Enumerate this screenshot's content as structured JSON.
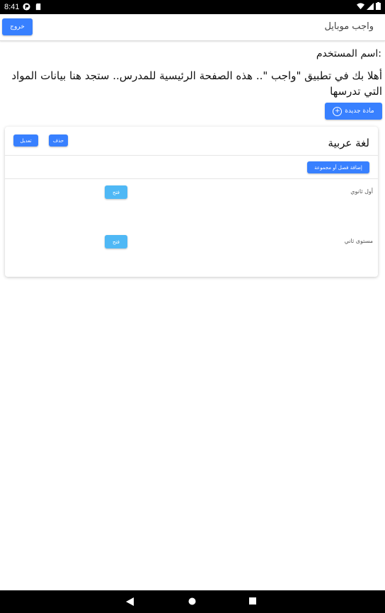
{
  "status": {
    "time": "8:41"
  },
  "appbar": {
    "title": "واجب موبايل",
    "logout_label": "خروج"
  },
  "main": {
    "username_label": "اسم المستخدم:",
    "welcome": "أهلا بك في تطبيق \"واجب \".. هذه الصفحة الرئيسية للمدرس.. ستجد هنا بيانات المواد التي تدرسها",
    "new_subject_label": "مادة جديدة"
  },
  "subject_card": {
    "title": "لغة عربية",
    "edit_label": "تعديل",
    "delete_label": "حذف",
    "add_class_label": "إضافة فصل أو مجموعة",
    "groups": [
      {
        "name": "أول ثانوي",
        "open_label": "فتح"
      },
      {
        "name": "مستوى ثاني",
        "open_label": "فتح"
      }
    ]
  },
  "colors": {
    "primary": "#3880ff",
    "open_button": "#4fb8f5"
  }
}
